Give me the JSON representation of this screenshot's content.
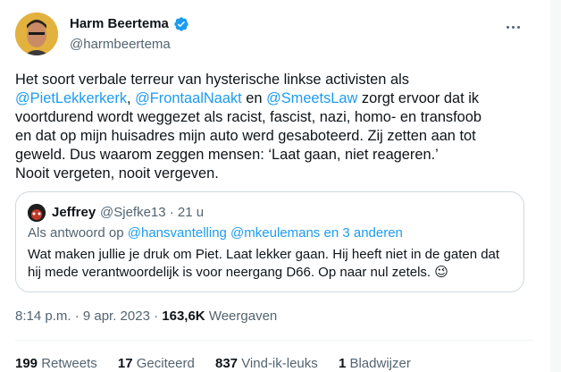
{
  "author": {
    "name": "Harm Beertema",
    "handle": "@harmbeertema"
  },
  "tweet": {
    "lines": [
      [
        "Het soort verbale terreur van hysterische linkse activisten als"
      ],
      [
        "@PietLekkerkerk",
        ", ",
        "@FrontaalNaakt",
        " en ",
        "@SmeetsLaw",
        " zorgt ervoor dat ik"
      ],
      [
        "voortdurend wordt weggezet als racist, fascist, nazi, homo- en transfoob"
      ],
      [
        "en dat op mijn huisadres mijn auto werd gesaboteerd. Zij zetten aan tot"
      ],
      [
        "geweld. Dus waarom zeggen mensen: ‘Laat gaan, niet reageren.’"
      ],
      [
        "Nooit vergeten, nooit vergeven."
      ]
    ],
    "mentions": [
      "@PietLekkerkerk",
      "@FrontaalNaakt",
      "@SmeetsLaw"
    ]
  },
  "quote": {
    "name": "Jeffrey",
    "handle_time": "@Sjefke13 · 21 u",
    "reply_prefix": "Als antwoord op",
    "reply_to": "@hansvantelling @mkeulemans",
    "reply_suffix": "en 3 anderen",
    "text": "Wat maken jullie je druk om Piet. Laat lekker gaan. Hij heeft niet in de gaten dat hij mede verantwoordelijk is voor neergang D66. Op naar nul zetels. 😉"
  },
  "meta": {
    "time": "8:14 p.m. · 9 apr. 2023 ·",
    "views_count": "163,6K",
    "views_label": "Weergaven"
  },
  "stats": [
    {
      "count": "199",
      "label": "Retweets"
    },
    {
      "count": "17",
      "label": "Geciteerd"
    },
    {
      "count": "837",
      "label": "Vind-ik-leuks"
    },
    {
      "count": "1",
      "label": "Bladwijzer"
    }
  ],
  "colors": {
    "accent": "#1d9bf0",
    "muted": "#536471",
    "text": "#0f1419",
    "border": "#cfd9de"
  },
  "icons": [
    "verified-badge-icon",
    "more-options-icon",
    "winking-face-emoji"
  ]
}
